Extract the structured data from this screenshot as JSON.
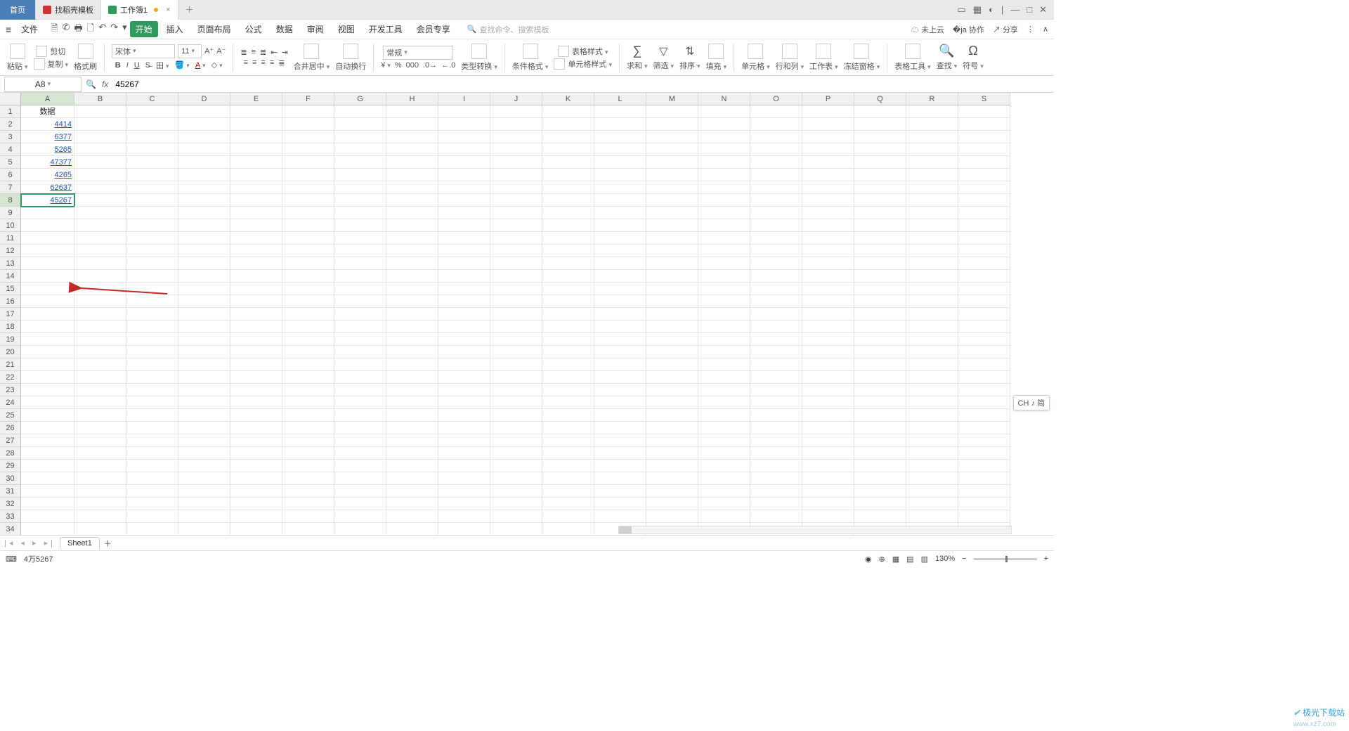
{
  "tabs": {
    "home": "首页",
    "template": "找稻壳模板",
    "workbook": "工作簿1"
  },
  "menu": {
    "file": "文件",
    "tabs": [
      "开始",
      "插入",
      "页面布局",
      "公式",
      "数据",
      "审阅",
      "视图",
      "开发工具",
      "会员专享"
    ],
    "search_ph": "查找命令、搜索模板",
    "cloud": "未上云",
    "collab": "协作",
    "share": "分享"
  },
  "ribbon": {
    "paste": "粘贴",
    "cut": "剪切",
    "copy": "复制",
    "fmt": "格式刷",
    "fontname": "宋体",
    "fontsize": "11",
    "merge": "合并居中",
    "wrap": "自动换行",
    "numfmt": "常规",
    "typecv": "类型转换",
    "condfmt": "条件格式",
    "tblstyle": "表格样式",
    "cellstyle": "单元格样式",
    "sum": "求和",
    "filter": "筛选",
    "sort": "排序",
    "fill": "填充",
    "cells": "单元格",
    "rowcol": "行和列",
    "sheet": "工作表",
    "freeze": "冻结窗格",
    "tbltool": "表格工具",
    "find": "查找",
    "symbol": "符号"
  },
  "namebox": "A8",
  "formula": "45267",
  "columns": [
    "A",
    "B",
    "C",
    "D",
    "E",
    "F",
    "G",
    "H",
    "I",
    "J",
    "K",
    "L",
    "M",
    "N",
    "O",
    "P",
    "Q",
    "R",
    "S"
  ],
  "rowcount": 34,
  "colA": {
    "header": "数据",
    "data": [
      "4414",
      "6377",
      "5265",
      "47377",
      "4265",
      "62637",
      "45267"
    ]
  },
  "active_row": 8,
  "ime": "CH ♪ 简",
  "sheet": "Sheet1",
  "status": {
    "reading": "4万5267",
    "zoom": "130%"
  },
  "watermark": {
    "a": "极光",
    "b": "下载站",
    "url": "www.xz7.com"
  }
}
